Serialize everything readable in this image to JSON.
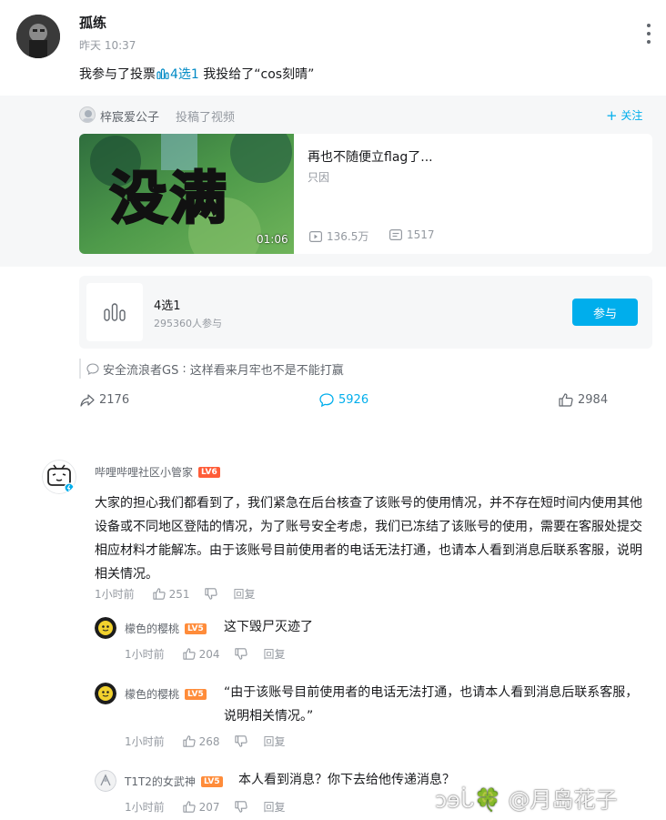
{
  "post": {
    "author": "孤练",
    "time": "昨天 10:37",
    "text_prefix": "我参与了投票",
    "vote_link": "4选1",
    "text_suffix": " 我投给了“cos刻晴”"
  },
  "forward": {
    "user": "梓宸爱公子",
    "action": "投稿了视频",
    "follow_label": "关注",
    "video": {
      "overlay_text": "没满",
      "duration": "01:06",
      "title": "再也不随便立flag了...",
      "uploader": "只因",
      "views": "136.5万",
      "danmaku": "1517"
    }
  },
  "vote": {
    "title": "4选1",
    "participants": "295360人参与",
    "join_label": "参与"
  },
  "top_comment": {
    "user": "安全流浪者GS",
    "text": "这样看来月牢也不是不能打赢"
  },
  "actions": {
    "share": "2176",
    "comment": "5926",
    "like": "2984"
  },
  "comments": [
    {
      "user": "哔哩哔哩社区小管家",
      "level": "LV6",
      "text": "大家的担心我们都看到了，我们紧急在后台核查了该账号的使用情况，并不存在短时间内使用其他设备或不同地区登陆的情况，为了账号安全考虑，我们已冻结了该账号的使用，需要在客服处提交相应材料才能解冻。由于该账号目前使用者的电话无法打通，也请本人看到消息后联系客服，说明相关情况。",
      "time": "1小时前",
      "likes": "251",
      "reply_label": "回复"
    }
  ],
  "replies": [
    {
      "user": "檬色的樱桃",
      "level": "LV5",
      "text": "这下毁尸灭迹了",
      "time": "1小时前",
      "likes": "204",
      "reply_label": "回复"
    },
    {
      "user": "檬色的樱桃",
      "level": "LV5",
      "text": "“由于该账号目前使用者的电话无法打通，也请本人看到消息后联系客服，说明相关情况。”",
      "time": "1小时前",
      "likes": "268",
      "reply_label": "回复"
    },
    {
      "user": "T1T2的女武神",
      "level": "LV5",
      "text": "本人看到消息？你下去给他传递消息？",
      "time": "1小时前",
      "likes": "207",
      "reply_label": "回复"
    }
  ],
  "watermark": "ↄɘᒑ🍀 @月岛花子",
  "colors": {
    "accent": "#00aeec",
    "link": "#008ac5",
    "text": "#18191c",
    "muted": "#9499a0",
    "level6": "#ff5c38",
    "level5": "#ff8c3a"
  }
}
